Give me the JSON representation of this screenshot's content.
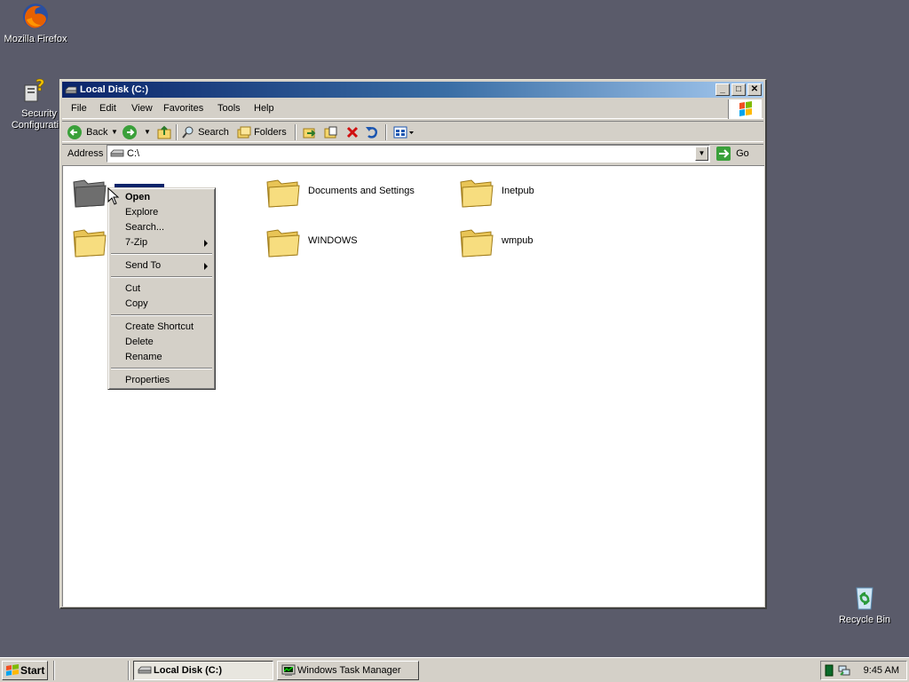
{
  "desktop": {
    "icons": [
      {
        "label": "Mozilla Firefox",
        "icon": "firefox-icon"
      },
      {
        "label": "Security Configurati...",
        "icon": "security-config-icon"
      },
      {
        "label": "Recycle Bin",
        "icon": "recycle-bin-icon"
      }
    ]
  },
  "window": {
    "title": "Local Disk (C:)",
    "menu": [
      "File",
      "Edit",
      "View",
      "Favorites",
      "Tools",
      "Help"
    ],
    "toolbar": {
      "back_label": "Back",
      "search_label": "Search",
      "folders_label": "Folders"
    },
    "address": {
      "label": "Address",
      "value": "C:\\",
      "go_label": "Go"
    },
    "folders": [
      {
        "name": ""
      },
      {
        "name": "Documents and Settings"
      },
      {
        "name": "Inetpub"
      },
      {
        "name": ""
      },
      {
        "name": "WINDOWS"
      },
      {
        "name": "wmpub"
      }
    ]
  },
  "context_menu": {
    "items": [
      {
        "label": "Open"
      },
      {
        "label": "Explore"
      },
      {
        "label": "Search..."
      },
      {
        "label": "7-Zip"
      },
      {
        "label": "Send To"
      },
      {
        "label": "Cut"
      },
      {
        "label": "Copy"
      },
      {
        "label": "Create Shortcut"
      },
      {
        "label": "Delete"
      },
      {
        "label": "Rename"
      },
      {
        "label": "Properties"
      }
    ]
  },
  "taskbar": {
    "start_label": "Start",
    "tasks": [
      {
        "label": "Local Disk (C:)"
      },
      {
        "label": "Windows Task Manager"
      }
    ],
    "clock": "9:45 AM"
  },
  "colors": {
    "desktop": "#5a5b6a",
    "titlebar_start": "#0a246a",
    "titlebar_end": "#a6caf0",
    "folder_yellow": "#f5d66b"
  }
}
